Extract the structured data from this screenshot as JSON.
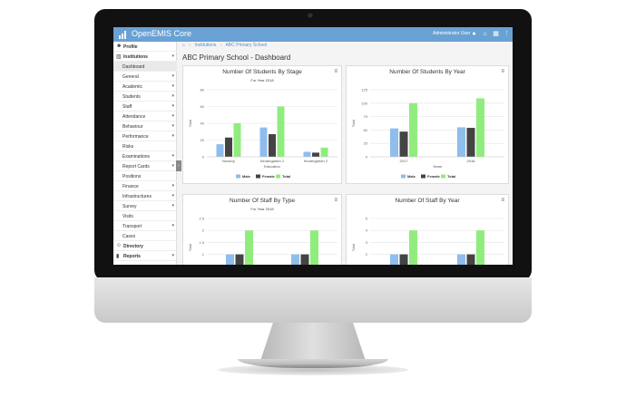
{
  "app": {
    "title": "OpenEMIS Core",
    "user": "Administrator User"
  },
  "breadcrumb": [
    "Institutions",
    "ABC Primary School"
  ],
  "page_title": "ABC Primary School - Dashboard",
  "sidebar": {
    "items": [
      {
        "label": "Profile",
        "icon": "person-icon",
        "bold": true
      },
      {
        "label": "Institutions",
        "icon": "building-icon",
        "bold": true,
        "chevron": "▾"
      },
      {
        "label": "Dashboard",
        "active": true
      },
      {
        "label": "General",
        "chevron": "▾"
      },
      {
        "label": "Academic",
        "chevron": "▾"
      },
      {
        "label": "Students",
        "chevron": "▾"
      },
      {
        "label": "Staff",
        "chevron": "▾"
      },
      {
        "label": "Attendance",
        "chevron": "▾"
      },
      {
        "label": "Behaviour",
        "chevron": "▾"
      },
      {
        "label": "Performance",
        "chevron": "▾"
      },
      {
        "label": "Risks"
      },
      {
        "label": "Examinations",
        "chevron": "▾"
      },
      {
        "label": "Report Cards",
        "chevron": "▾"
      },
      {
        "label": "Positions"
      },
      {
        "label": "Finance",
        "chevron": "▾"
      },
      {
        "label": "Infrastructures",
        "chevron": "▾"
      },
      {
        "label": "Survey",
        "chevron": "▾"
      },
      {
        "label": "Visits"
      },
      {
        "label": "Transport",
        "chevron": "▾"
      },
      {
        "label": "Cases"
      },
      {
        "label": "Directory",
        "icon": "people-icon",
        "bold": true
      },
      {
        "label": "Reports",
        "icon": "chart-icon",
        "bold": true,
        "chevron": "▾"
      }
    ]
  },
  "colors": {
    "male": "#8fbdec",
    "female": "#444444",
    "total": "#90ed7d",
    "topbar": "#6aa1d4"
  },
  "legend": [
    "Male",
    "Female",
    "Total"
  ],
  "chart_data": [
    {
      "type": "bar",
      "title": "Number Of Students By Stage",
      "subtitle": "For Year 2018",
      "categories": [
        "Nursery",
        "Kindergarten 1",
        "Kindergarten 2"
      ],
      "xlabel": "Education",
      "ylabel": "Total",
      "ylim": [
        0,
        80
      ],
      "yticks": [
        0,
        20,
        40,
        60,
        80
      ],
      "legend": true,
      "series": [
        {
          "name": "Male",
          "values": [
            15,
            35,
            6
          ]
        },
        {
          "name": "Female",
          "values": [
            23,
            27,
            5
          ]
        },
        {
          "name": "Total",
          "values": [
            40,
            60,
            11
          ]
        }
      ]
    },
    {
      "type": "bar",
      "title": "Number Of Students By Year",
      "subtitle": "",
      "categories": [
        "2017",
        "2018"
      ],
      "xlabel": "Years",
      "ylabel": "Total",
      "ylim": [
        0,
        125
      ],
      "yticks": [
        0,
        25,
        50,
        75,
        100,
        125
      ],
      "legend": true,
      "series": [
        {
          "name": "Male",
          "values": [
            53,
            55
          ]
        },
        {
          "name": "Female",
          "values": [
            47,
            54
          ]
        },
        {
          "name": "Total",
          "values": [
            100,
            109
          ]
        }
      ]
    },
    {
      "type": "bar",
      "title": "Number Of Staff By Type",
      "subtitle": "For Year 2018",
      "categories": [
        "",
        ""
      ],
      "xlabel": "",
      "ylabel": "Total",
      "ylim": [
        0,
        2.5
      ],
      "yticks": [
        1,
        1.5,
        2,
        2.5
      ],
      "legend": false,
      "series": [
        {
          "name": "Male",
          "values": [
            1,
            1
          ]
        },
        {
          "name": "Female",
          "values": [
            1,
            1
          ]
        },
        {
          "name": "Total",
          "values": [
            2,
            2
          ]
        }
      ]
    },
    {
      "type": "bar",
      "title": "Number Of Staff By Year",
      "subtitle": "",
      "categories": [
        "",
        ""
      ],
      "xlabel": "",
      "ylabel": "Total",
      "ylim": [
        0,
        5
      ],
      "yticks": [
        2,
        3,
        4,
        5
      ],
      "legend": false,
      "series": [
        {
          "name": "Male",
          "values": [
            2,
            2
          ]
        },
        {
          "name": "Female",
          "values": [
            2,
            2
          ]
        },
        {
          "name": "Total",
          "values": [
            4,
            4
          ]
        }
      ]
    }
  ]
}
